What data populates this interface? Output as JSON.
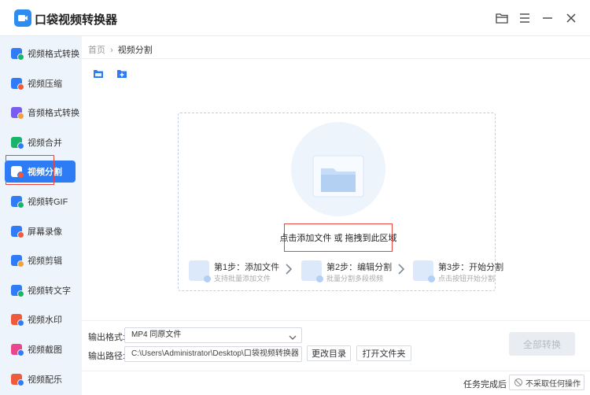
{
  "app": {
    "title": "口袋视频转换器"
  },
  "window_controls": [
    "folder-icon",
    "menu-icon",
    "minimize-icon",
    "close-icon"
  ],
  "sidebar": {
    "items": [
      {
        "label": "视频格式转换",
        "icon": "video-convert-icon",
        "color": "#2f7cf6",
        "badge": "#19b36b",
        "active": false
      },
      {
        "label": "视频压缩",
        "icon": "video-compress-icon",
        "color": "#2f7cf6",
        "badge": "#f05a3c",
        "active": false
      },
      {
        "label": "音频格式转换",
        "icon": "audio-convert-icon",
        "color": "#7a5cf0",
        "badge": "#f0a13c",
        "active": false
      },
      {
        "label": "视频合并",
        "icon": "video-merge-icon",
        "color": "#19b36b",
        "badge": "#2f7cf6",
        "active": false
      },
      {
        "label": "视频分割",
        "icon": "video-split-icon",
        "color": "#f05a3c",
        "badge": "#ffffff",
        "active": true
      },
      {
        "label": "视频转GIF",
        "icon": "video-gif-icon",
        "color": "#2f7cf6",
        "badge": "#19b36b",
        "active": false
      },
      {
        "label": "屏幕录像",
        "icon": "screen-record-icon",
        "color": "#2f7cf6",
        "badge": "#f05a3c",
        "active": false
      },
      {
        "label": "视频剪辑",
        "icon": "video-edit-icon",
        "color": "#2f7cf6",
        "badge": "#f0a13c",
        "active": false
      },
      {
        "label": "视频转文字",
        "icon": "video-text-icon",
        "color": "#2f7cf6",
        "badge": "#19b36b",
        "active": false
      },
      {
        "label": "视频水印",
        "icon": "video-watermark-icon",
        "color": "#f05a3c",
        "badge": "#2f7cf6",
        "active": false
      },
      {
        "label": "视频截图",
        "icon": "video-screenshot-icon",
        "color": "#e8478f",
        "badge": "#2f7cf6",
        "active": false
      },
      {
        "label": "视频配乐",
        "icon": "video-music-icon",
        "color": "#f05a3c",
        "badge": "#2f7cf6",
        "active": false
      }
    ]
  },
  "breadcrumb": {
    "home": "首页",
    "separator": "›",
    "current": "视频分割"
  },
  "toolbar": {
    "add_file_icon": "file-icon",
    "add_folder_icon": "add-folder-icon"
  },
  "dropzone": {
    "hint": "点击添加文件 或 拖拽到此区域",
    "steps": [
      {
        "title": "第1步：添加文件",
        "subtitle": "支持批量添加文件"
      },
      {
        "title": "第2步：编辑分割",
        "subtitle": "批量分割多段视频"
      },
      {
        "title": "第3步：开始分割",
        "subtitle": "点击按钮开始分割"
      }
    ]
  },
  "output": {
    "format_label": "输出格式:",
    "format_value": "MP4  同原文件",
    "path_label": "输出路径:",
    "path_value": "C:\\Users\\Administrator\\Desktop\\口袋视频转换器",
    "change_dir_label": "更改目录",
    "open_folder_label": "打开文件夹",
    "convert_all_label": "全部转换"
  },
  "footer": {
    "after_task_label": "任务完成后",
    "after_task_value": "不采取任何操作"
  },
  "colors": {
    "accent": "#2d7cf6",
    "sidebar_bg": "#eef4fb",
    "highlight_outline": "#e8473f",
    "disabled_button": "#e9ecf1"
  }
}
